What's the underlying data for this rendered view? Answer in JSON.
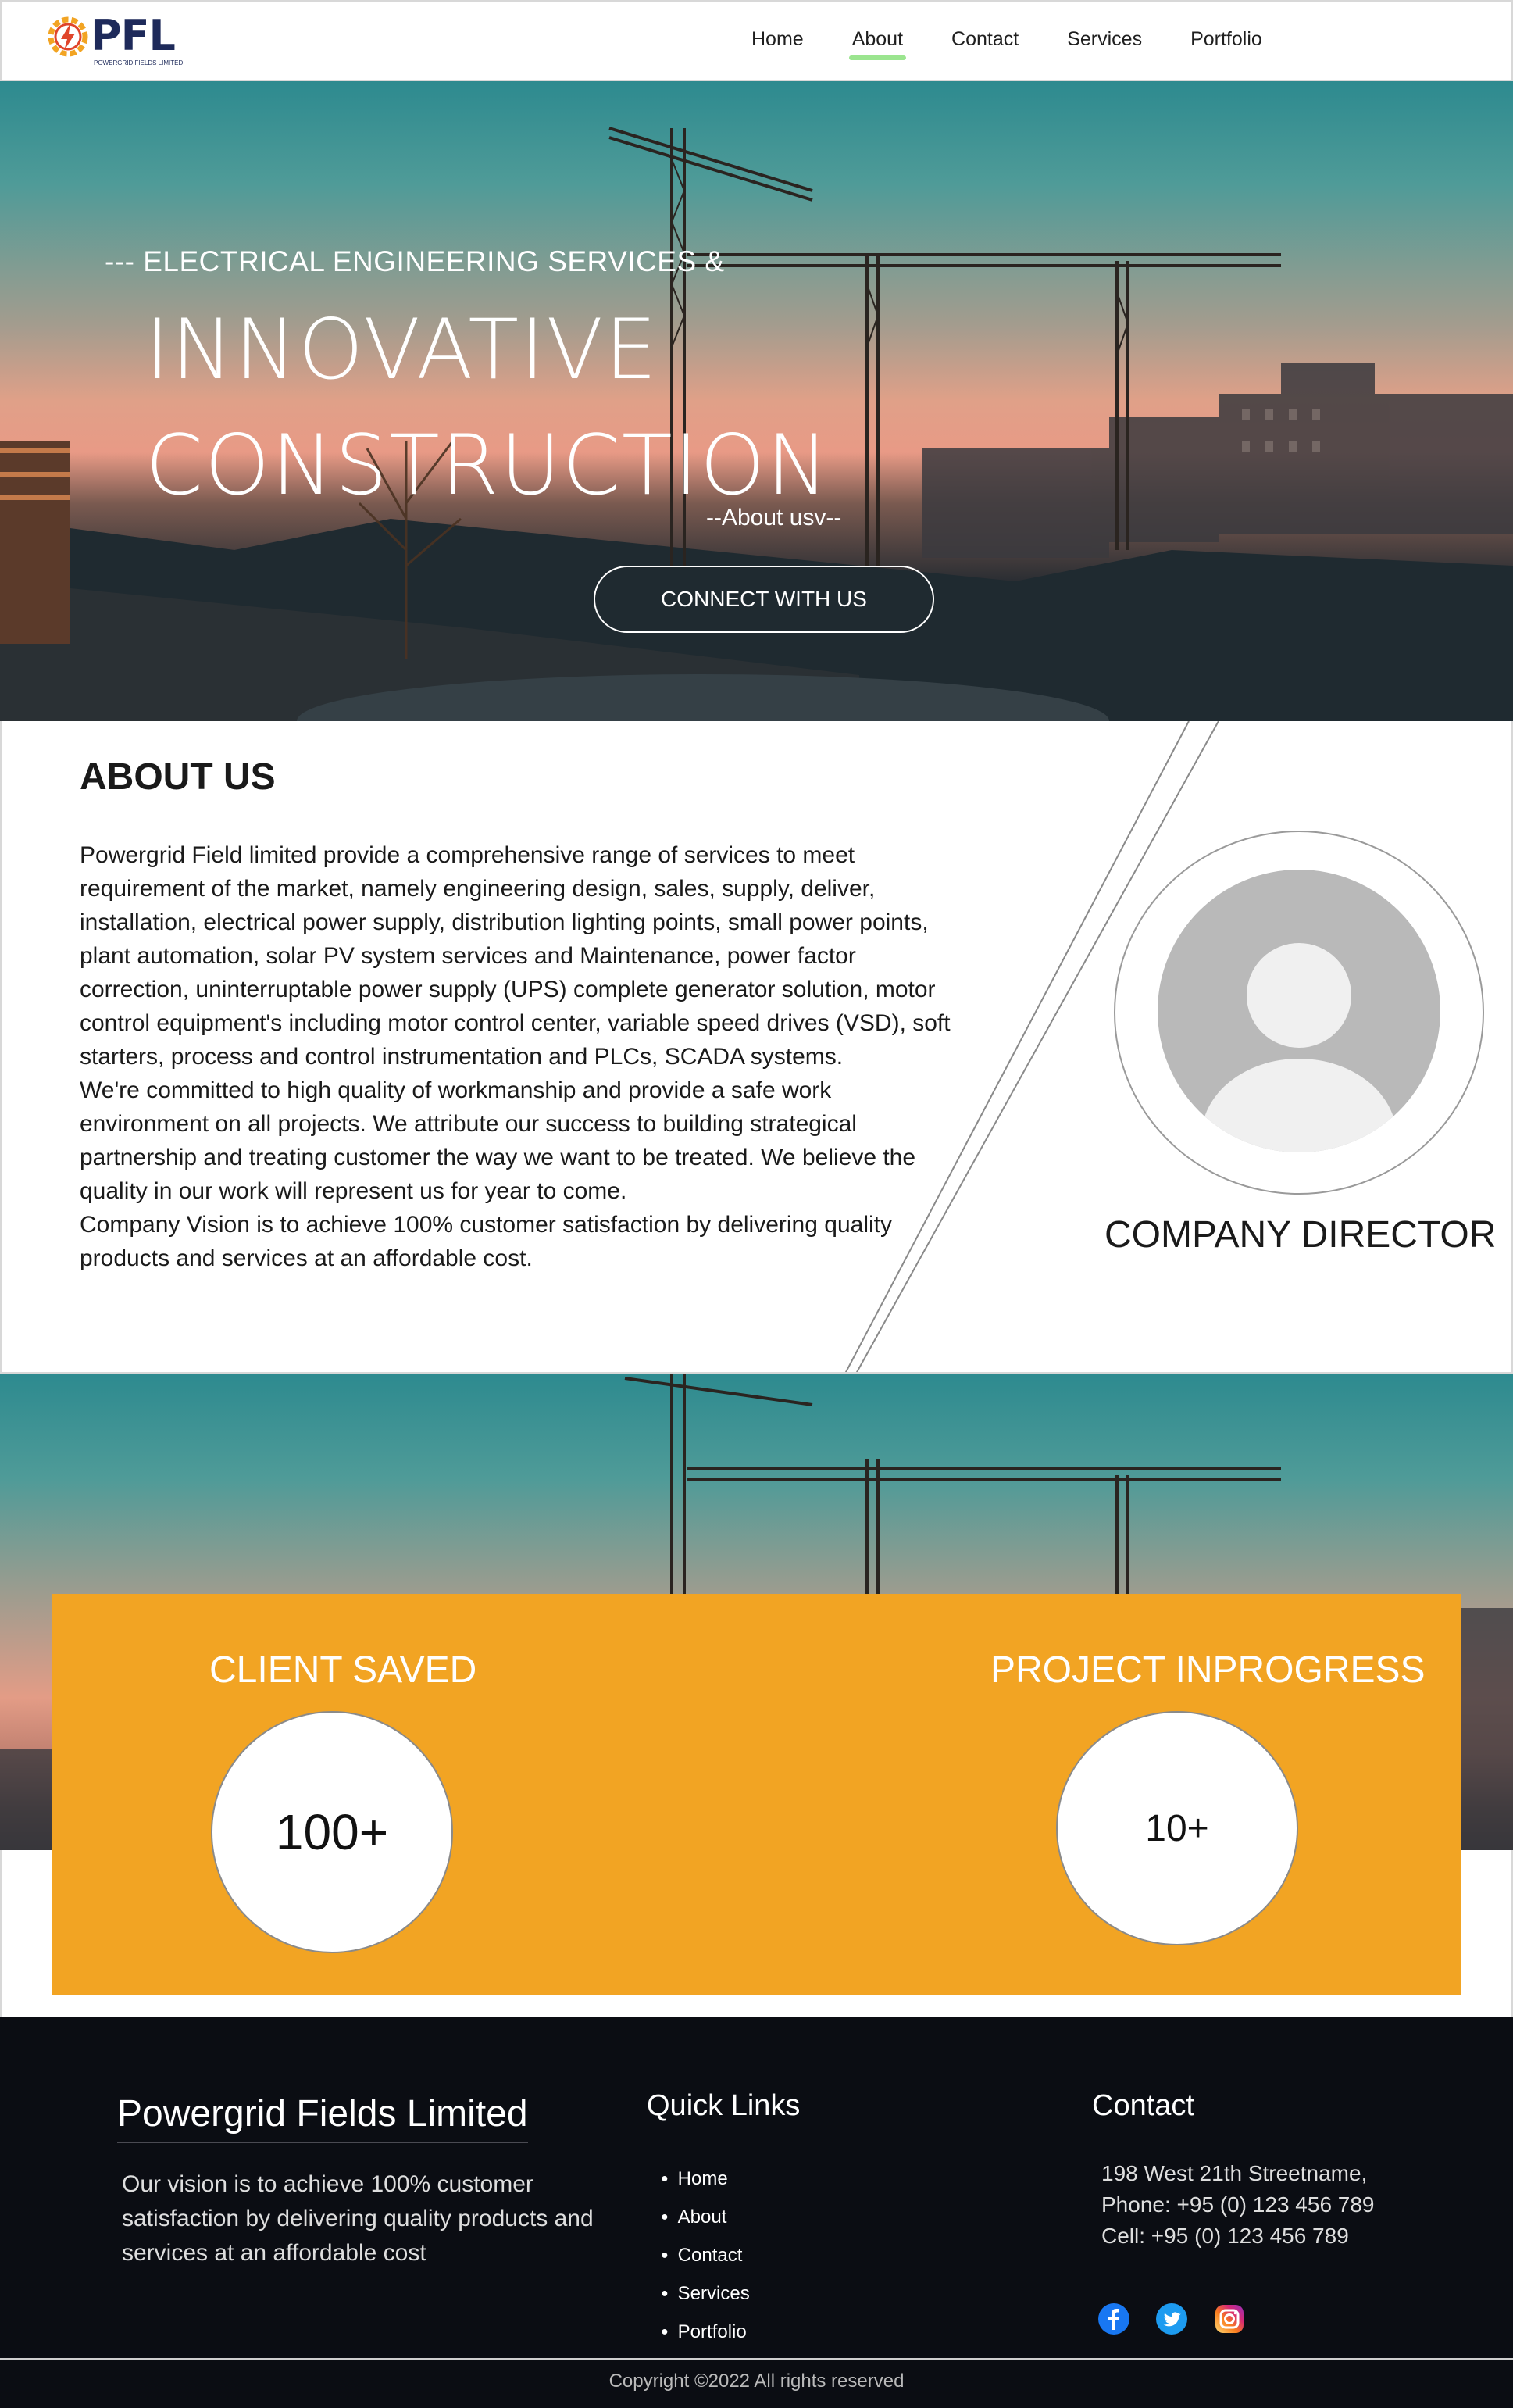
{
  "header": {
    "logo_text": "PFL",
    "logo_sub": "POWERGRID FIELDS LIMITED",
    "nav": [
      {
        "label": "Home",
        "active": false
      },
      {
        "label": "About",
        "active": true
      },
      {
        "label": "Contact",
        "active": false
      },
      {
        "label": "Services",
        "active": false
      },
      {
        "label": "Portfolio",
        "active": false
      }
    ]
  },
  "hero": {
    "kicker": "--- ELECTRICAL ENGINEERING SERVICES &",
    "title_line1": "INNOVATIVE",
    "title_line2": "CONSTRUCTION",
    "link": "--About usv--",
    "cta": "CONNECT WITH US"
  },
  "about": {
    "title": "ABOUT US",
    "paragraphs": [
      "Powergrid Field limited provide a comprehensive range of services to meet requirement of the market, namely engineering design, sales, supply, deliver, installation, electrical power supply, distribution lighting points, small power points, plant automation, solar PV system services and Maintenance, power factor correction, uninterruptable power supply (UPS) complete generator solution, motor control equipment's including motor control center, variable speed  drives (VSD), soft starters, process and control instrumentation and PLCs, SCADA systems.",
      "We're committed to high quality of workmanship and provide a safe work environment on all projects. We attribute our success to building strategical partnership and treating customer the way we want to be treated. We believe the quality in our work will represent us for year to come.",
      "Company Vision is to achieve 100% customer satisfaction by delivering quality products and services at an affordable cost."
    ],
    "director_label": "COMPANY DIRECTOR"
  },
  "stats": {
    "client_label": "CLIENT SAVED",
    "client_value": "100+",
    "project_label": "PROJECT INPROGRESS",
    "project_value": "10+"
  },
  "footer": {
    "brand": "Powergrid Fields Limited",
    "vision": "Our vision is to achieve 100% customer satisfaction by delivering quality products and services at an affordable cost",
    "quick_links_title": "Quick Links",
    "quick_links": [
      "Home",
      "About",
      "Contact",
      "Services",
      "Portfolio"
    ],
    "contact_title": "Contact",
    "address": "198 West 21th Streetname,",
    "phone": "Phone: +95 (0) 123 456 789",
    "cell": "Cell: +95 (0) 123 456 789",
    "socials": [
      "facebook-icon",
      "twitter-icon",
      "instagram-icon"
    ],
    "copyright": "Copyright ©2022 All rights reserved"
  },
  "colors": {
    "accent_orange": "#f2a423",
    "nav_underline": "#9be58f",
    "footer_bg": "#0b0d13",
    "logo_navy": "#1e2a5a"
  }
}
